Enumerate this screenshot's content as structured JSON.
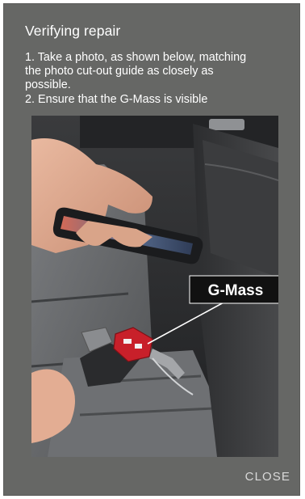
{
  "dialog": {
    "title": "Verifying repair",
    "instructions": [
      "1. Take a photo, as shown below, matching",
      "the photo cut-out guide as closely as",
      "possible.",
      "2. Ensure that the G-Mass is visible"
    ],
    "photo": {
      "callout_label": "G-Mass"
    },
    "close_label": "CLOSE"
  },
  "colors": {
    "dialog_background": "#666765",
    "text_primary": "#ffffff",
    "button_text": "#d9d9d9",
    "component_red": "#c8202a"
  }
}
